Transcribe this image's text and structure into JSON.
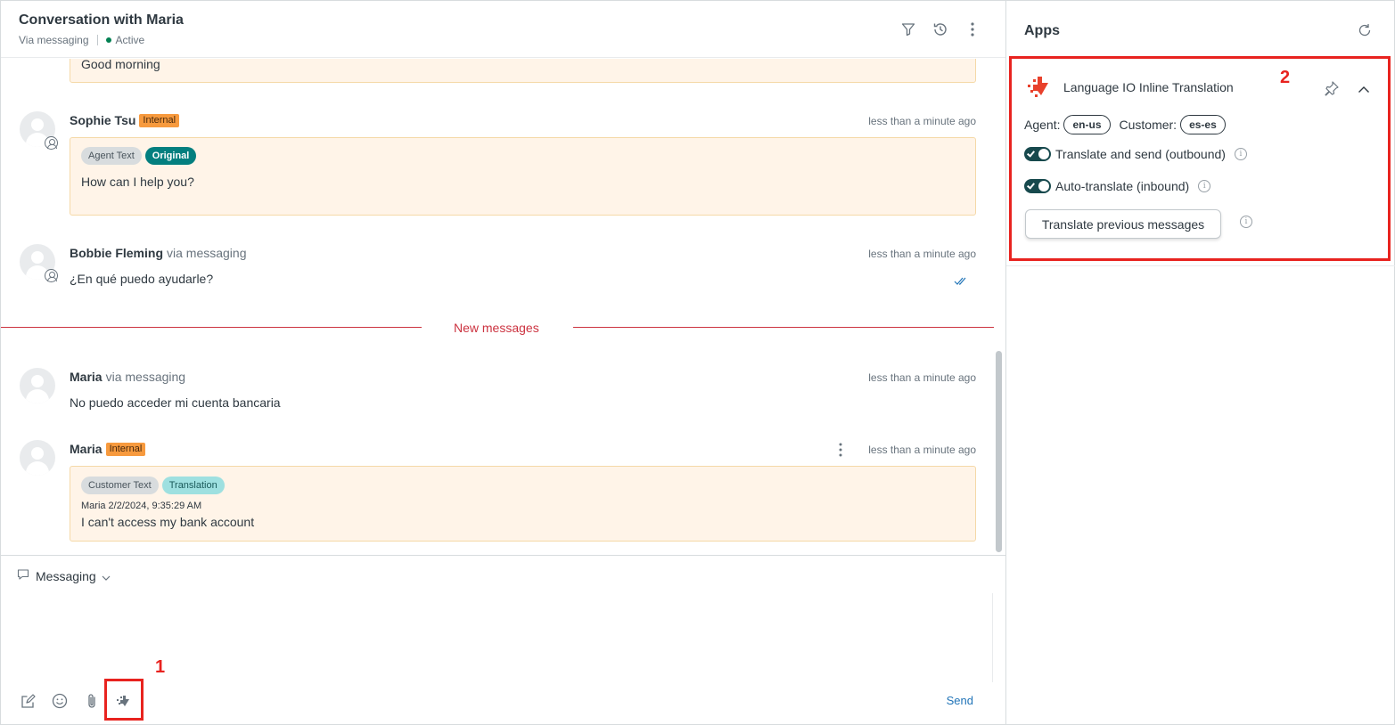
{
  "conversation": {
    "title": "Conversation with Maria",
    "channel_via": "Via messaging",
    "status": "Active"
  },
  "header_icons": [
    "filter-icon",
    "history-icon",
    "more-vertical-icon"
  ],
  "messages": [
    {
      "text": "Good morning"
    },
    {
      "sender": "Sophie Tsu",
      "tag": "Internal",
      "time": "less than a minute ago",
      "pills": [
        "Agent Text",
        "Original"
      ],
      "text": "How can I help you?"
    },
    {
      "sender": "Bobbie Fleming",
      "via": "via messaging",
      "time": "less than a minute ago",
      "text": "¿En qué puedo ayudarle?"
    },
    {
      "sender": "Maria",
      "via": "via messaging",
      "time": "less than a minute ago",
      "text": "No puedo acceder mi cuenta bancaria"
    },
    {
      "sender": "Maria",
      "tag": "Internal",
      "time": "less than a minute ago",
      "pills": [
        "Customer Text",
        "Translation"
      ],
      "meta": "Maria 2/2/2024, 9:35:29 AM",
      "text": "I can't access my bank account"
    }
  ],
  "new_messages_label": "New messages",
  "composer": {
    "channel_label": "Messaging",
    "send_label": "Send",
    "tools": [
      "compose-icon",
      "emoji-icon",
      "attachment-icon",
      "language-io-icon"
    ]
  },
  "annotations": {
    "one": "1",
    "two": "2"
  },
  "apps": {
    "title": "Apps",
    "app_name": "Language IO Inline Translation",
    "agent_label": "Agent:",
    "agent_lang": "en-us",
    "customer_label": "Customer:",
    "customer_lang": "es-es",
    "toggle_outbound": "Translate and send (outbound)",
    "toggle_inbound": "Auto-translate (inbound)",
    "outbound_on": true,
    "inbound_on": true,
    "translate_button": "Translate previous messages"
  },
  "colors": {
    "accent_red": "#e8231f",
    "internal_tag": "#f79a3e",
    "bubble_bg": "#fff4e8",
    "toggle_on": "#17494d",
    "active_green": "#038153",
    "link_blue": "#1f73b7"
  }
}
